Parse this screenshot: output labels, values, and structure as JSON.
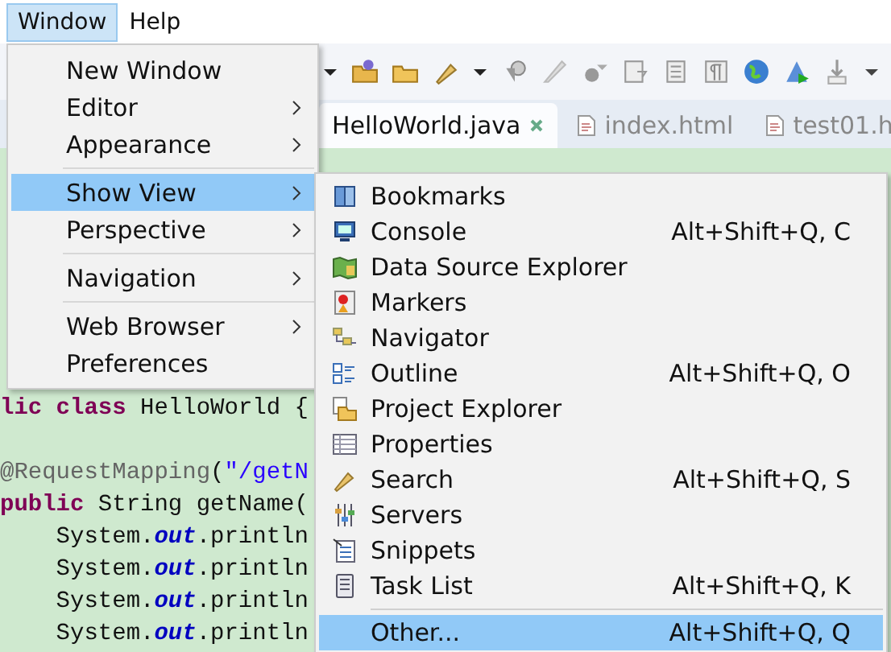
{
  "menubar": [
    {
      "label": "Window",
      "selected": true
    },
    {
      "label": "Help",
      "selected": false
    }
  ],
  "tabs": [
    {
      "label": "HelloWorld.java",
      "selected": true
    },
    {
      "label": "index.html",
      "selected": false
    },
    {
      "label": "test01.h",
      "selected": false
    }
  ],
  "editor": {
    "lines": [
      [
        {
          "text": "lic class",
          "kind": "keyword"
        },
        {
          "text": " HelloWorld {",
          "kind": "plain"
        }
      ],
      [
        {
          "text": "@RequestMapping",
          "kind": "annotation",
          "blank_before": true
        },
        {
          "text": "(",
          "kind": "plain"
        },
        {
          "text": "\"/getN",
          "kind": "string"
        }
      ],
      [
        {
          "text": "public",
          "kind": "keyword"
        },
        {
          "text": " String getName(",
          "kind": "plain"
        }
      ],
      [
        {
          "text": "    System.",
          "kind": "plain"
        },
        {
          "text": "out",
          "kind": "field"
        },
        {
          "text": ".println",
          "kind": "plain"
        }
      ],
      [
        {
          "text": "    System.",
          "kind": "plain"
        },
        {
          "text": "out",
          "kind": "field"
        },
        {
          "text": ".println",
          "kind": "plain"
        }
      ],
      [
        {
          "text": "    System.",
          "kind": "plain"
        },
        {
          "text": "out",
          "kind": "field"
        },
        {
          "text": ".println",
          "kind": "plain"
        }
      ],
      [
        {
          "text": "    System.",
          "kind": "plain"
        },
        {
          "text": "out",
          "kind": "field"
        },
        {
          "text": ".println",
          "kind": "plain"
        }
      ]
    ]
  },
  "window_menu": {
    "items": [
      {
        "kind": "item",
        "label": "New Window",
        "has_submenu": false,
        "selected": false
      },
      {
        "kind": "item",
        "label": "Editor",
        "has_submenu": true,
        "selected": false
      },
      {
        "kind": "item",
        "label": "Appearance",
        "has_submenu": true,
        "selected": false
      },
      {
        "kind": "separator"
      },
      {
        "kind": "item",
        "label": "Show View",
        "has_submenu": true,
        "selected": true
      },
      {
        "kind": "item",
        "label": "Perspective",
        "has_submenu": true,
        "selected": false
      },
      {
        "kind": "separator"
      },
      {
        "kind": "item",
        "label": "Navigation",
        "has_submenu": true,
        "selected": false
      },
      {
        "kind": "separator"
      },
      {
        "kind": "item",
        "label": "Web Browser",
        "has_submenu": true,
        "selected": false
      },
      {
        "kind": "item",
        "label": "Preferences",
        "has_submenu": false,
        "selected": false
      }
    ]
  },
  "show_view_menu": {
    "items": [
      {
        "kind": "item",
        "label": "Bookmarks",
        "selected": false
      },
      {
        "kind": "item",
        "label": "Console",
        "shortcut": "Alt+Shift+Q, C",
        "selected": false
      },
      {
        "kind": "item",
        "label": "Data Source Explorer",
        "selected": false
      },
      {
        "kind": "item",
        "label": "Markers",
        "selected": false
      },
      {
        "kind": "item",
        "label": "Navigator",
        "selected": false
      },
      {
        "kind": "item",
        "label": "Outline",
        "shortcut": "Alt+Shift+Q, O",
        "selected": false
      },
      {
        "kind": "item",
        "label": "Project Explorer",
        "selected": false
      },
      {
        "kind": "item",
        "label": "Properties",
        "selected": false
      },
      {
        "kind": "item",
        "label": "Search",
        "shortcut": "Alt+Shift+Q, S",
        "selected": false
      },
      {
        "kind": "item",
        "label": "Servers",
        "selected": false
      },
      {
        "kind": "item",
        "label": "Snippets",
        "selected": false
      },
      {
        "kind": "item",
        "label": "Task List",
        "shortcut": "Alt+Shift+Q, K",
        "selected": false
      },
      {
        "kind": "separator"
      },
      {
        "kind": "item",
        "label": "Other...",
        "shortcut": "Alt+Shift+Q, Q",
        "selected": true
      }
    ]
  }
}
